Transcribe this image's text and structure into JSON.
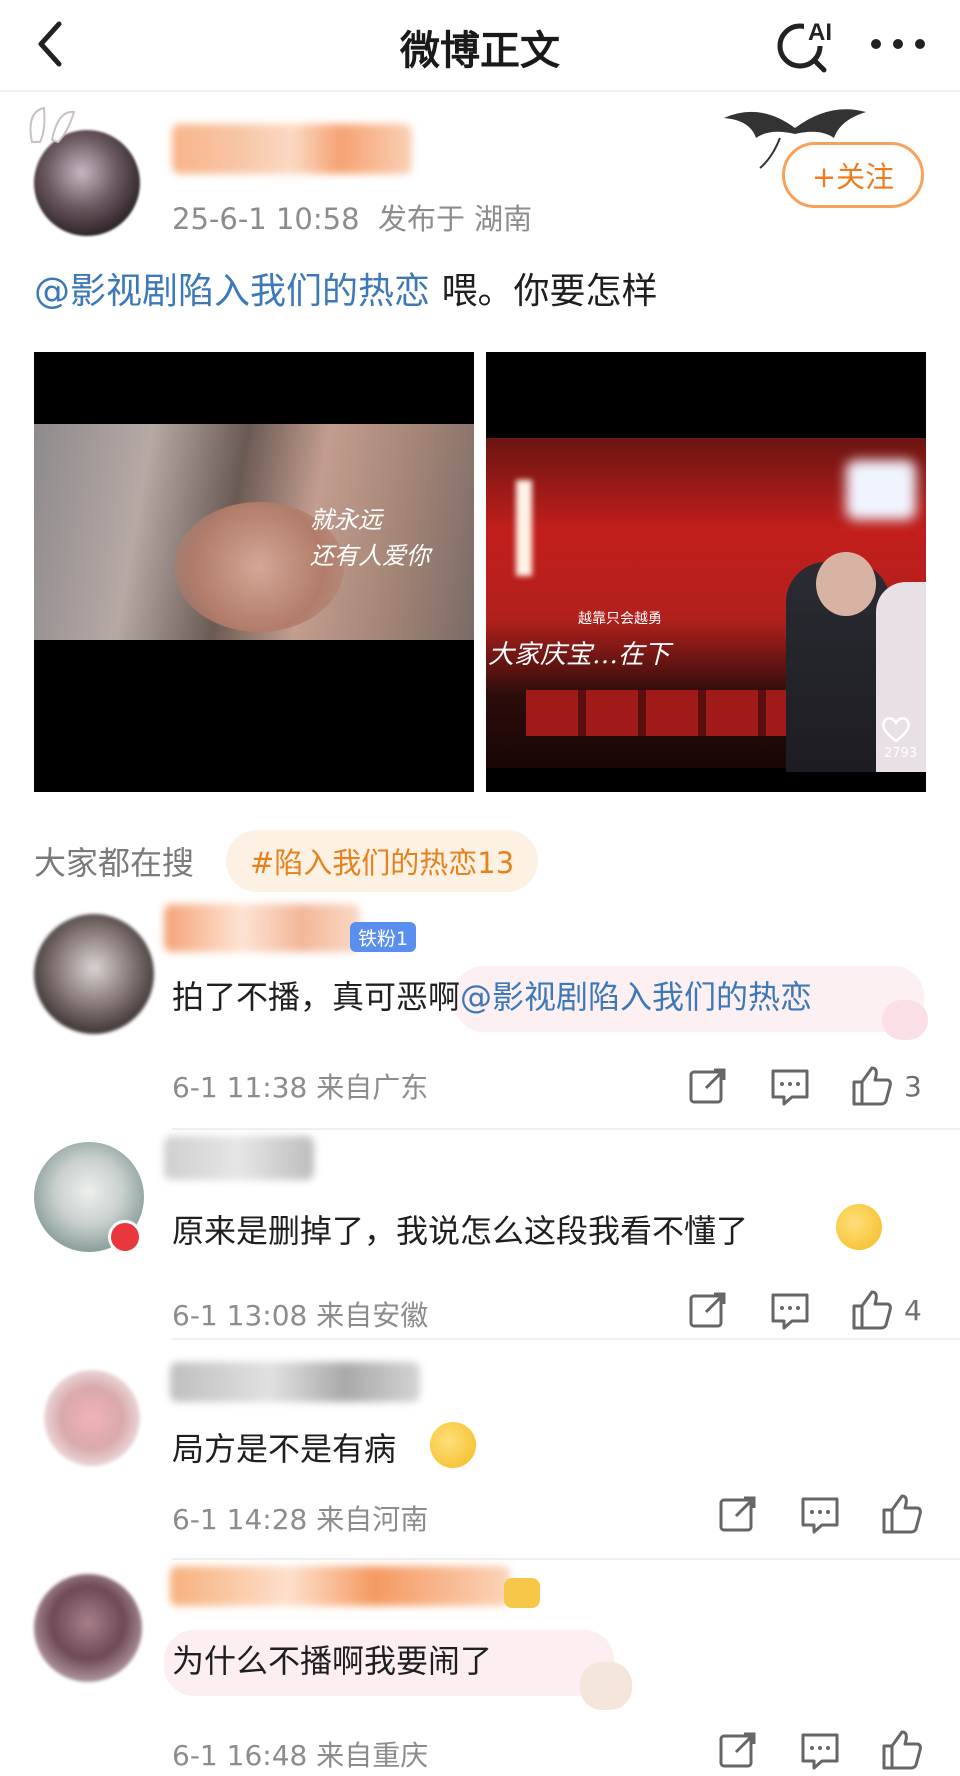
{
  "header": {
    "title": "微博正文",
    "ai_label": "AI"
  },
  "post": {
    "timestamp": "25-6-1 10:58",
    "location": "发布于 湖南",
    "follow_label": "+关注",
    "mention": "@影视剧陷入我们的热恋",
    "text": " 喂。你要怎样"
  },
  "images": [
    {
      "caption_line1": "就永远",
      "caption_line2": "还有人爱你"
    },
    {
      "subtitle_small": "越靠只会越勇",
      "subtitle_main": "大家庆宝…在下",
      "likes": "2793"
    }
  ],
  "everyone_searching": {
    "label": "大家都在搜",
    "tag": "#陷入我们的热恋13"
  },
  "comments": [
    {
      "badge": "铁粉1",
      "text": "拍了不播，真可恶啊",
      "mention": "@影视剧陷入我们的热恋",
      "time": "6-1 11:38  来自广东",
      "likes": "3"
    },
    {
      "text": "原来是删掉了，我说怎么这段我看不懂了",
      "time": "6-1 13:08  来自安徽",
      "likes": "4"
    },
    {
      "text": "局方是不是有病",
      "time": "6-1 14:28  来自河南",
      "likes": ""
    },
    {
      "text": "为什么不播啊我要闹了",
      "time": "6-1 16:48  来自重庆",
      "likes": ""
    }
  ],
  "colors": {
    "accent_orange": "#f07a1c",
    "mention_blue": "#3d79b9",
    "meta_gray": "#8c8c8c"
  }
}
